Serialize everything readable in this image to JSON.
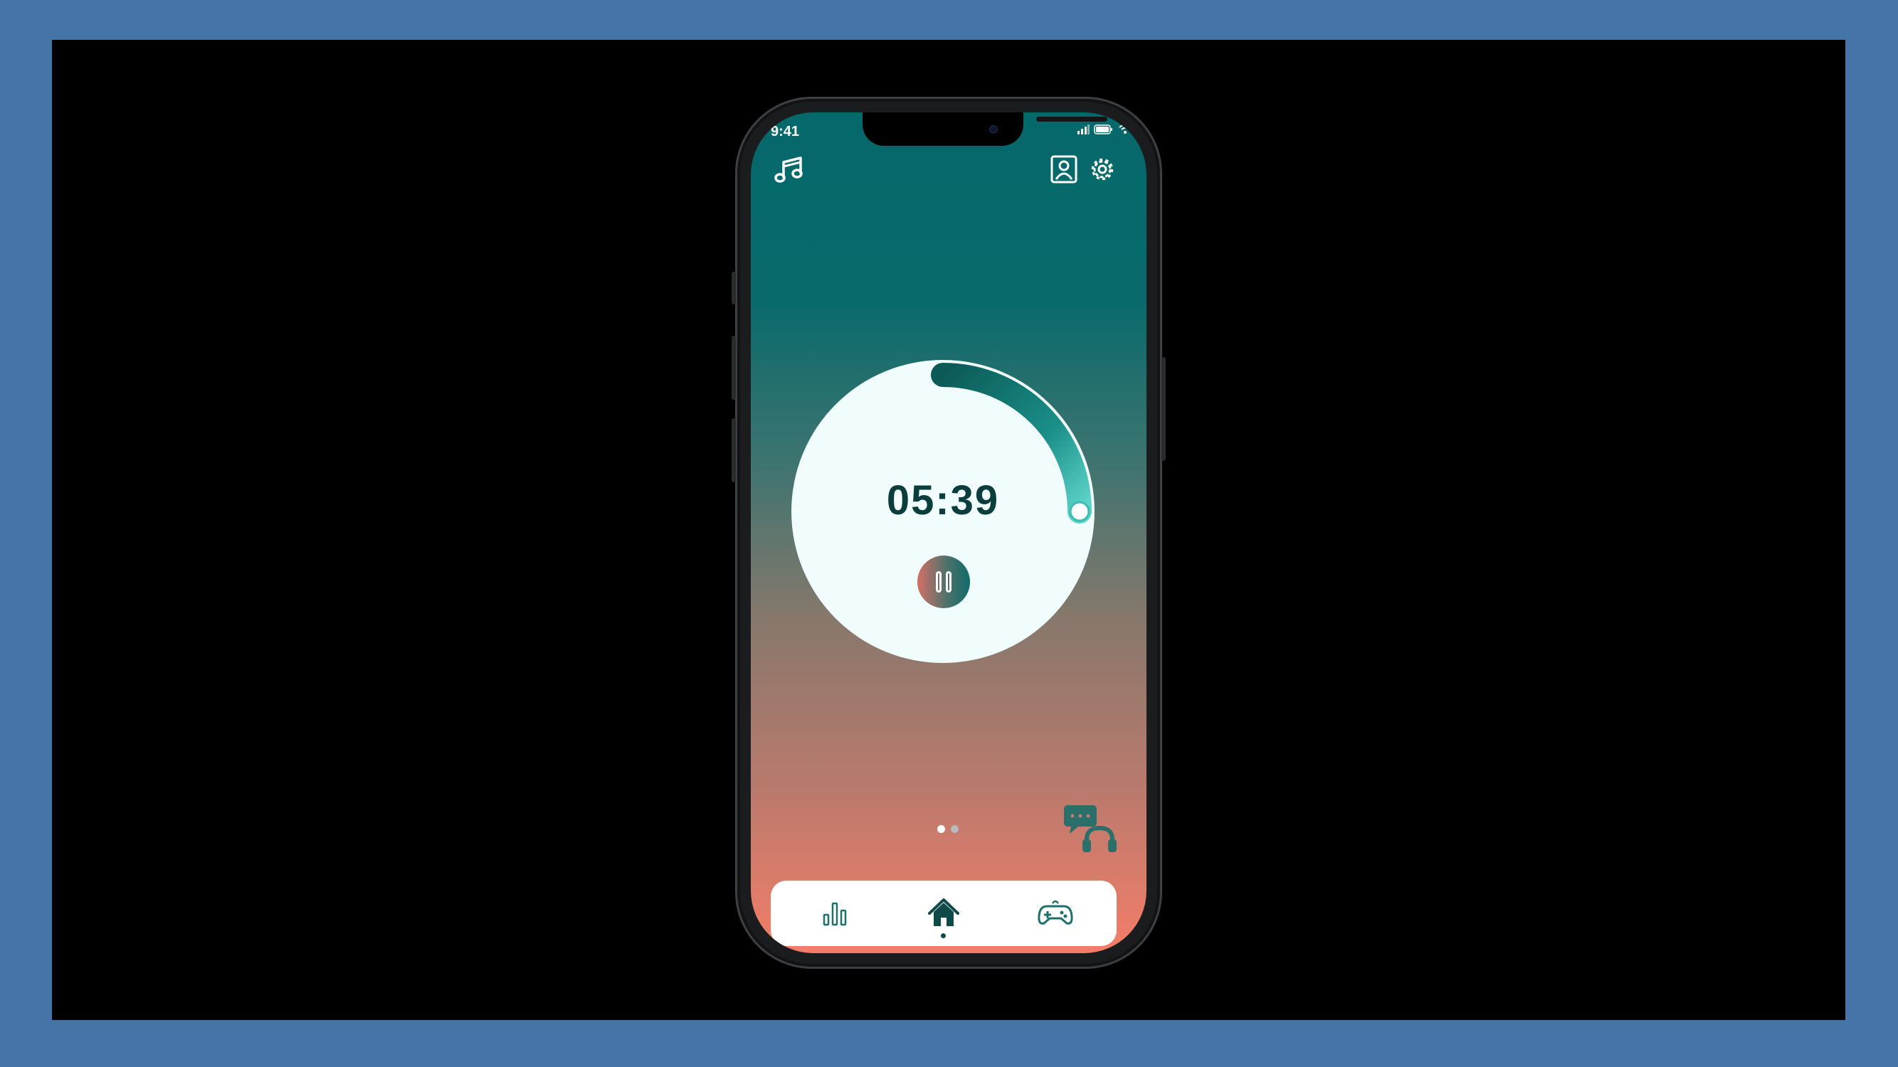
{
  "status_bar": {
    "time": "9:41"
  },
  "timer": {
    "display": "05:39",
    "progress": 0.25
  },
  "pager": {
    "total": 2,
    "active": 0
  },
  "nav": {
    "items": [
      "stats-icon",
      "home-icon",
      "gamepad-icon"
    ],
    "active": 1
  },
  "colors": {
    "background_frame": "#4575a8",
    "gradient_top": "#05686a",
    "gradient_bottom": "#f47d68",
    "timer_text": "#0b3d3c",
    "accent": "#1a8f88",
    "nav_icon": "#1f6f6b"
  }
}
